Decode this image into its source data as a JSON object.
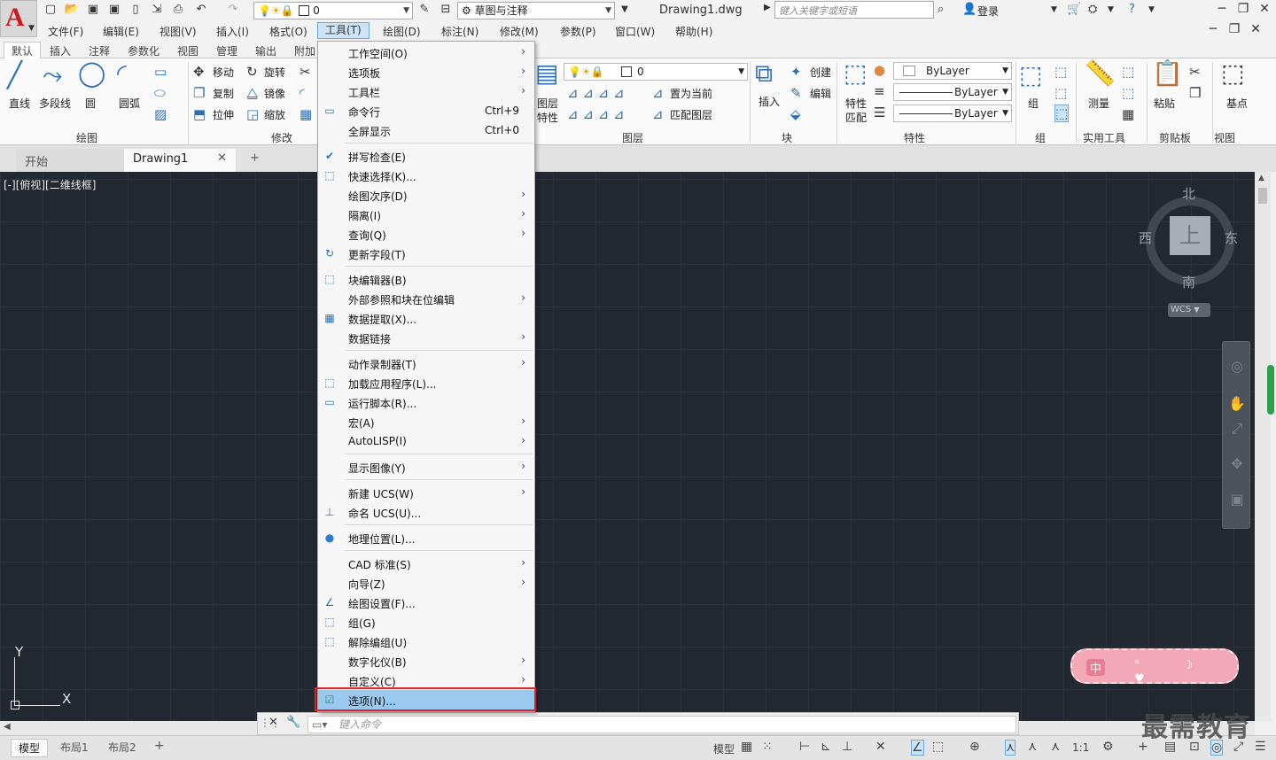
{
  "titlebar": {
    "layer_value": "0",
    "workspace": "草图与注释",
    "document_title": "Drawing1.dwg",
    "search_placeholder": "键入关键字或短语",
    "login": "登录"
  },
  "menubar": [
    "文件(F)",
    "编辑(E)",
    "视图(V)",
    "插入(I)",
    "格式(O)",
    "工具(T)",
    "绘图(D)",
    "标注(N)",
    "修改(M)",
    "参数(P)",
    "窗口(W)",
    "帮助(H)"
  ],
  "ribbon_tabs": [
    "默认",
    "插入",
    "注释",
    "参数化",
    "视图",
    "管理",
    "输出",
    "附加"
  ],
  "ribbon": {
    "draw": {
      "line": "直线",
      "polyline": "多段线",
      "circle": "圆",
      "arc": "圆弧",
      "title": "绘图"
    },
    "modify": {
      "move": "移动",
      "rotate": "旋转",
      "copy": "复制",
      "mirror": "镜像",
      "stretch": "拉伸",
      "scale": "缩放",
      "title": "修改"
    },
    "layers": {
      "layer_props_1": "图层",
      "layer_props_2": "特性",
      "current_layer": "0",
      "make_current": "置为当前",
      "match_layer": "匹配图层",
      "title": "图层"
    },
    "block": {
      "insert": "插入",
      "create": "创建",
      "edit": "编辑",
      "title": "块"
    },
    "properties": {
      "match_1": "特性",
      "match_2": "匹配",
      "color": "ByLayer",
      "linetype": "ByLayer",
      "lineweight": "ByLayer",
      "title": "特性"
    },
    "group": {
      "group": "组",
      "title": "组"
    },
    "utilities": {
      "measure": "测量",
      "title": "实用工具"
    },
    "clipboard": {
      "paste": "粘贴",
      "title": "剪贴板"
    },
    "view": {
      "base": "基点",
      "title": "视图"
    }
  },
  "file_tabs": {
    "start": "开始",
    "drawing": "Drawing1"
  },
  "canvas": {
    "view_label": "[-][俯视][二维线框]",
    "ucs_x": "X",
    "ucs_y": "Y"
  },
  "viewcube": {
    "north": "北",
    "south": "南",
    "east": "东",
    "west": "西",
    "top": "上",
    "wcs": "WCS"
  },
  "ime": {
    "mode": "中"
  },
  "tools_menu": [
    {
      "label": "工作空间(O)",
      "submenu": true,
      "icon": ""
    },
    {
      "label": "选项板",
      "submenu": true,
      "icon": ""
    },
    {
      "label": "工具栏",
      "submenu": true,
      "icon": ""
    },
    {
      "label": "命令行",
      "shortcut": "Ctrl+9",
      "icon": "command-line-icon"
    },
    {
      "label": "全屏显示",
      "shortcut": "Ctrl+0",
      "icon": ""
    },
    {
      "label": "拼写检查(E)",
      "icon": "spell-check-icon"
    },
    {
      "label": "快速选择(K)...",
      "icon": "quick-select-icon"
    },
    {
      "label": "绘图次序(D)",
      "submenu": true,
      "icon": ""
    },
    {
      "label": "隔离(I)",
      "submenu": true,
      "icon": ""
    },
    {
      "label": "查询(Q)",
      "submenu": true,
      "icon": ""
    },
    {
      "label": "更新字段(T)",
      "icon": "update-field-icon"
    },
    {
      "label": "块编辑器(B)",
      "icon": "block-editor-icon"
    },
    {
      "label": "外部参照和块在位编辑",
      "submenu": true,
      "icon": ""
    },
    {
      "label": "数据提取(X)...",
      "icon": "data-extraction-icon"
    },
    {
      "label": "数据链接",
      "submenu": true,
      "icon": ""
    },
    {
      "label": "动作录制器(T)",
      "submenu": true,
      "icon": ""
    },
    {
      "label": "加载应用程序(L)...",
      "icon": "load-application-icon"
    },
    {
      "label": "运行脚本(R)...",
      "icon": "run-script-icon"
    },
    {
      "label": "宏(A)",
      "submenu": true,
      "icon": ""
    },
    {
      "label": "AutoLISP(I)",
      "submenu": true,
      "icon": ""
    },
    {
      "label": "显示图像(Y)",
      "submenu": true,
      "icon": ""
    },
    {
      "label": "新建 UCS(W)",
      "submenu": true,
      "icon": ""
    },
    {
      "label": "命名 UCS(U)...",
      "icon": "named-ucs-icon"
    },
    {
      "label": "地理位置(L)...",
      "icon": "globe-icon"
    },
    {
      "label": "CAD 标准(S)",
      "submenu": true,
      "icon": ""
    },
    {
      "label": "向导(Z)",
      "submenu": true,
      "icon": ""
    },
    {
      "label": "绘图设置(F)...",
      "icon": "drafting-settings-icon"
    },
    {
      "label": "组(G)",
      "icon": "group-icon"
    },
    {
      "label": "解除编组(U)",
      "icon": "ungroup-icon"
    },
    {
      "label": "数字化仪(B)",
      "submenu": true,
      "icon": ""
    },
    {
      "label": "自定义(C)",
      "submenu": true,
      "icon": ""
    },
    {
      "label": "选项(N)...",
      "icon": "options-check-icon"
    }
  ],
  "command_line": {
    "placeholder": "键入命令"
  },
  "status_tabs": {
    "model": "模型",
    "layout1": "布局1",
    "layout2": "布局2"
  },
  "statusbar": {
    "model": "模型",
    "scale": "1:1"
  },
  "watermark": "最需教育"
}
